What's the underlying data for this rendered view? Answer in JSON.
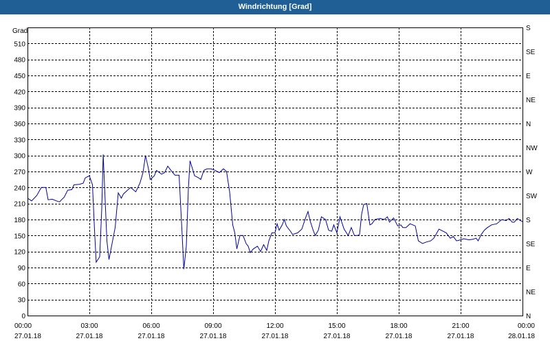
{
  "window": {
    "title": "Windrichtung [Grad]"
  },
  "chart_data": {
    "type": "line",
    "title": "Windrichtung [Grad]",
    "ylabel": "Grad",
    "ylim": [
      0,
      540
    ],
    "xlim": [
      "27.01.18 00:00",
      "28.01.18 00:00"
    ],
    "grid": true,
    "line_color": "#00009a",
    "y_ticks": [
      0,
      30,
      60,
      90,
      120,
      150,
      180,
      210,
      240,
      270,
      300,
      330,
      360,
      390,
      420,
      450,
      480,
      510
    ],
    "right_ticks": [
      {
        "deg": 0,
        "label": "N"
      },
      {
        "deg": 45,
        "label": "NE"
      },
      {
        "deg": 90,
        "label": "E"
      },
      {
        "deg": 135,
        "label": "SE"
      },
      {
        "deg": 180,
        "label": "S"
      },
      {
        "deg": 225,
        "label": "SW"
      },
      {
        "deg": 270,
        "label": "W"
      },
      {
        "deg": 315,
        "label": "NW"
      },
      {
        "deg": 360,
        "label": "N"
      },
      {
        "deg": 405,
        "label": "NE"
      },
      {
        "deg": 450,
        "label": "E"
      },
      {
        "deg": 495,
        "label": "SE"
      },
      {
        "deg": 540,
        "label": "S"
      }
    ],
    "x_ticks": [
      {
        "hour": 0,
        "time": "00:00",
        "date": "27.01.18"
      },
      {
        "hour": 3,
        "time": "03:00",
        "date": "27.01.18"
      },
      {
        "hour": 6,
        "time": "06:00",
        "date": "27.01.18"
      },
      {
        "hour": 9,
        "time": "09:00",
        "date": "27.01.18"
      },
      {
        "hour": 12,
        "time": "12:00",
        "date": "27.01.18"
      },
      {
        "hour": 15,
        "time": "15:00",
        "date": "27.01.18"
      },
      {
        "hour": 18,
        "time": "18:00",
        "date": "27.01.18"
      },
      {
        "hour": 21,
        "time": "21:00",
        "date": "27.01.18"
      },
      {
        "hour": 24,
        "time": "00:00",
        "date": "28.01.18"
      }
    ],
    "series": [
      {
        "values": [
          [
            0.0,
            220
          ],
          [
            0.2,
            215
          ],
          [
            0.45,
            225
          ],
          [
            0.67,
            240
          ],
          [
            0.89,
            240
          ],
          [
            1.0,
            217
          ],
          [
            1.2,
            218
          ],
          [
            1.4,
            215
          ],
          [
            1.55,
            213
          ],
          [
            1.78,
            222
          ],
          [
            1.95,
            235
          ],
          [
            2.15,
            236
          ],
          [
            2.25,
            245
          ],
          [
            2.5,
            246
          ],
          [
            2.7,
            248
          ],
          [
            2.8,
            258
          ],
          [
            3.0,
            262
          ],
          [
            3.15,
            245
          ],
          [
            3.25,
            160
          ],
          [
            3.33,
            100
          ],
          [
            3.5,
            110
          ],
          [
            3.6,
            200
          ],
          [
            3.67,
            302
          ],
          [
            3.75,
            230
          ],
          [
            3.85,
            140
          ],
          [
            3.95,
            105
          ],
          [
            4.05,
            125
          ],
          [
            4.25,
            165
          ],
          [
            4.4,
            230
          ],
          [
            4.55,
            220
          ],
          [
            4.65,
            228
          ],
          [
            4.85,
            235
          ],
          [
            5.0,
            240
          ],
          [
            5.25,
            232
          ],
          [
            5.45,
            248
          ],
          [
            5.6,
            268
          ],
          [
            5.72,
            300
          ],
          [
            5.85,
            278
          ],
          [
            5.95,
            255
          ],
          [
            6.15,
            262
          ],
          [
            6.25,
            272
          ],
          [
            6.5,
            265
          ],
          [
            6.65,
            268
          ],
          [
            6.8,
            280
          ],
          [
            7.0,
            270
          ],
          [
            7.15,
            263
          ],
          [
            7.35,
            263
          ],
          [
            7.5,
            150
          ],
          [
            7.58,
            87
          ],
          [
            7.7,
            130
          ],
          [
            7.8,
            238
          ],
          [
            7.88,
            290
          ],
          [
            8.0,
            275
          ],
          [
            8.1,
            262
          ],
          [
            8.3,
            258
          ],
          [
            8.4,
            255
          ],
          [
            8.55,
            272
          ],
          [
            8.7,
            275
          ],
          [
            8.9,
            275
          ],
          [
            9.1,
            272
          ],
          [
            9.3,
            268
          ],
          [
            9.5,
            275
          ],
          [
            9.65,
            270
          ],
          [
            9.8,
            232
          ],
          [
            9.95,
            170
          ],
          [
            10.05,
            155
          ],
          [
            10.15,
            125
          ],
          [
            10.3,
            150
          ],
          [
            10.45,
            150
          ],
          [
            10.6,
            135
          ],
          [
            10.7,
            130
          ],
          [
            10.8,
            118
          ],
          [
            10.95,
            125
          ],
          [
            11.15,
            130
          ],
          [
            11.3,
            120
          ],
          [
            11.45,
            133
          ],
          [
            11.6,
            122
          ],
          [
            11.7,
            140
          ],
          [
            11.85,
            155
          ],
          [
            12.0,
            155
          ],
          [
            12.1,
            172
          ],
          [
            12.2,
            160
          ],
          [
            12.35,
            170
          ],
          [
            12.45,
            180
          ],
          [
            12.55,
            168
          ],
          [
            12.75,
            158
          ],
          [
            12.85,
            152
          ],
          [
            13.1,
            155
          ],
          [
            13.3,
            162
          ],
          [
            13.5,
            185
          ],
          [
            13.6,
            195
          ],
          [
            13.7,
            178
          ],
          [
            13.85,
            160
          ],
          [
            13.95,
            150
          ],
          [
            14.1,
            160
          ],
          [
            14.25,
            185
          ],
          [
            14.45,
            180
          ],
          [
            14.6,
            160
          ],
          [
            14.75,
            158
          ],
          [
            14.85,
            170
          ],
          [
            15.0,
            155
          ],
          [
            15.15,
            185
          ],
          [
            15.35,
            162
          ],
          [
            15.55,
            150
          ],
          [
            15.7,
            165
          ],
          [
            15.85,
            150
          ],
          [
            16.0,
            150
          ],
          [
            16.1,
            152
          ],
          [
            16.2,
            190
          ],
          [
            16.3,
            208
          ],
          [
            16.45,
            210
          ],
          [
            16.6,
            170
          ],
          [
            16.7,
            172
          ],
          [
            16.85,
            180
          ],
          [
            17.1,
            182
          ],
          [
            17.3,
            180
          ],
          [
            17.45,
            185
          ],
          [
            17.55,
            175
          ],
          [
            17.75,
            183
          ],
          [
            17.95,
            168
          ],
          [
            18.1,
            170
          ],
          [
            18.2,
            165
          ],
          [
            18.35,
            165
          ],
          [
            18.55,
            172
          ],
          [
            18.8,
            168
          ],
          [
            18.95,
            140
          ],
          [
            19.15,
            135
          ],
          [
            19.35,
            138
          ],
          [
            19.55,
            140
          ],
          [
            19.7,
            145
          ],
          [
            19.85,
            155
          ],
          [
            19.95,
            162
          ],
          [
            20.15,
            158
          ],
          [
            20.3,
            155
          ],
          [
            20.5,
            145
          ],
          [
            20.65,
            148
          ],
          [
            20.8,
            140
          ],
          [
            21.0,
            142
          ],
          [
            21.15,
            144
          ],
          [
            21.4,
            142
          ],
          [
            21.6,
            143
          ],
          [
            21.75,
            145
          ],
          [
            21.85,
            140
          ],
          [
            22.0,
            152
          ],
          [
            22.15,
            160
          ],
          [
            22.3,
            165
          ],
          [
            22.5,
            170
          ],
          [
            22.75,
            172
          ],
          [
            23.0,
            180
          ],
          [
            23.2,
            178
          ],
          [
            23.35,
            182
          ],
          [
            23.5,
            175
          ],
          [
            23.6,
            175
          ],
          [
            23.75,
            182
          ],
          [
            23.9,
            178
          ],
          [
            24.0,
            176
          ]
        ]
      }
    ]
  }
}
